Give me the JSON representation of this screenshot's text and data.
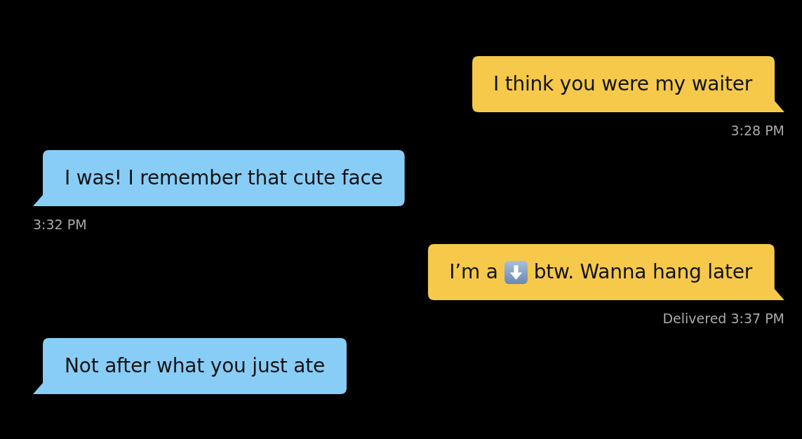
{
  "messages": [
    {
      "kind": "outgoing",
      "segments": [
        {
          "kind": "text",
          "text": "I think you were my waiter"
        }
      ],
      "footer": "3:28 PM"
    },
    {
      "kind": "incoming",
      "segments": [
        {
          "kind": "text",
          "text": "I was! I remember that cute face"
        }
      ],
      "footer": "3:32 PM"
    },
    {
      "kind": "outgoing",
      "segments": [
        {
          "kind": "text",
          "text": "I’m a"
        },
        {
          "kind": "emoji"
        },
        {
          "kind": "text",
          "text": "btw. Wanna hang later"
        }
      ],
      "footer": "Delivered 3:37 PM"
    },
    {
      "kind": "incoming",
      "segments": [
        {
          "kind": "text",
          "text": "Not after what you just ate"
        }
      ]
    }
  ]
}
